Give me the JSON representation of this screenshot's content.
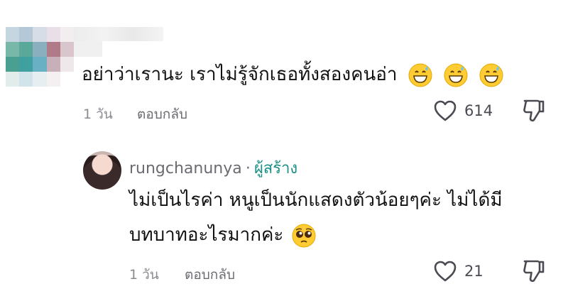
{
  "comment1": {
    "text": "อย่าว่าเรานะ เราไม่รู้จักเธอทั้งสองคนอ่า",
    "emojis": [
      "grinning-sweat-emoji",
      "grinning-sweat-emoji",
      "grinning-sweat-emoji"
    ],
    "time": "1 วัน",
    "reply_label": "ตอบกลับ",
    "likes": "614"
  },
  "comment2": {
    "username": "rungchanunya",
    "separator": "·",
    "badge": "ผู้สร้าง",
    "line1": "ไม่เป็นไรค่า หนูเป็นนักแสดงตัวน้อยๆค่ะ ไม่ได้มี",
    "line2": "บทบาทอะไรมากค่ะ",
    "emoji": "pleading-face-emoji",
    "time": "1 วัน",
    "reply_label": "ตอบกลับ",
    "likes": "21"
  },
  "colors": {
    "creator_accent": "#1a8f85",
    "meta_gray": "#8a8b91",
    "emoji_yellow": "#ffcc33"
  }
}
